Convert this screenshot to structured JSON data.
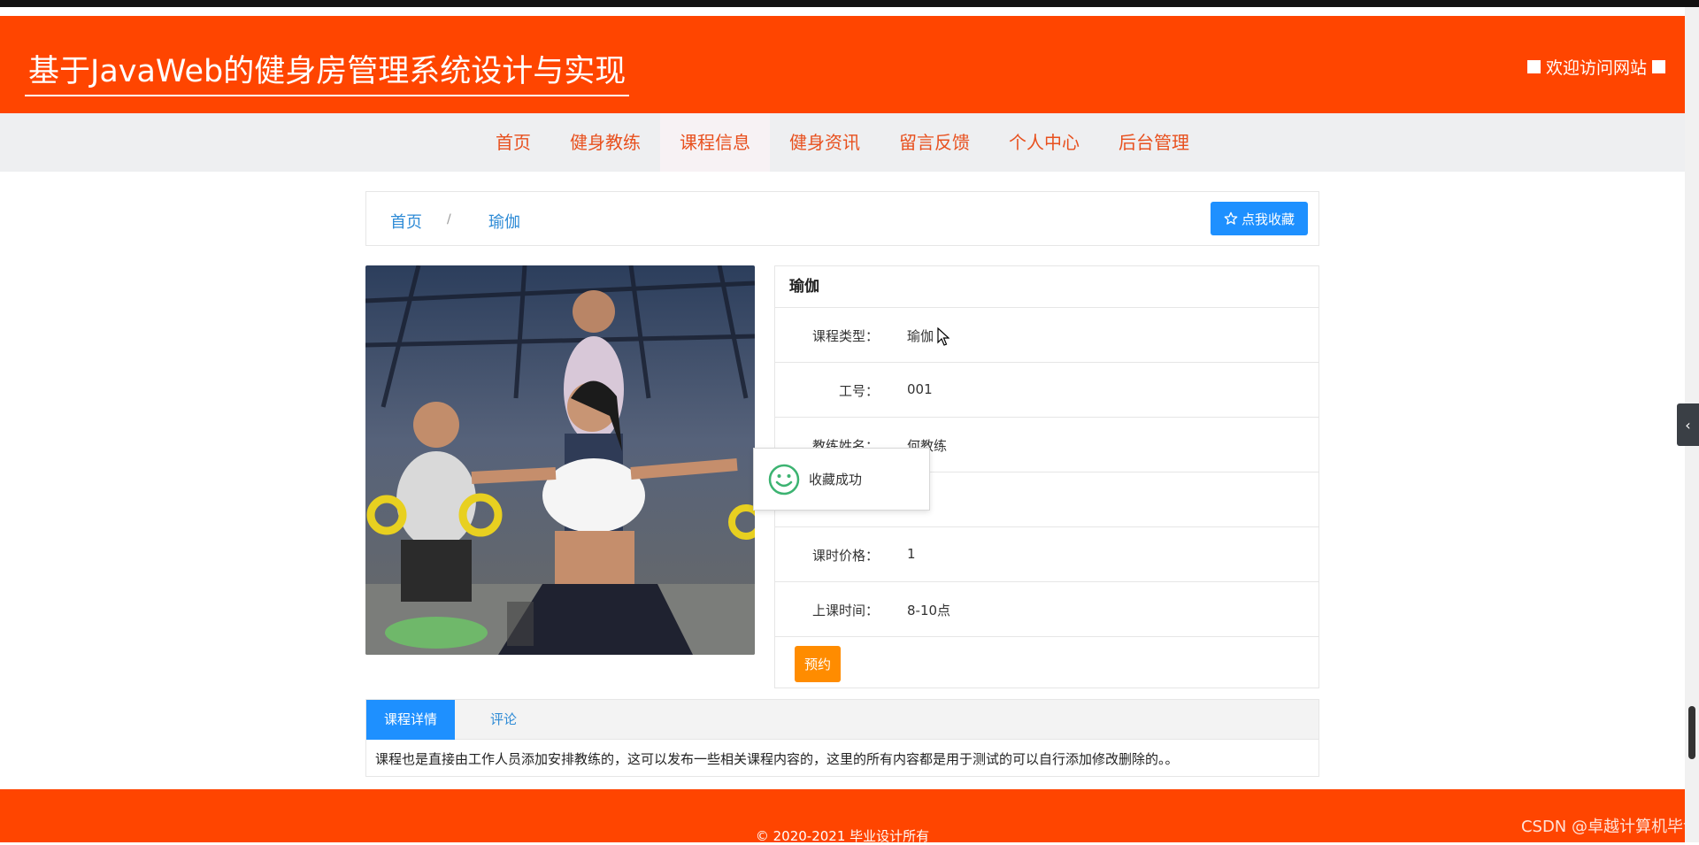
{
  "header": {
    "site_title": "基于JavaWeb的健身房管理系统设计与实现",
    "welcome_text": "欢迎访问网站"
  },
  "nav": {
    "items": [
      {
        "label": "首页"
      },
      {
        "label": "健身教练"
      },
      {
        "label": "课程信息",
        "active": true
      },
      {
        "label": "健身资讯"
      },
      {
        "label": "留言反馈"
      },
      {
        "label": "个人中心"
      },
      {
        "label": "后台管理"
      }
    ]
  },
  "breadcrumb": {
    "home": "首页",
    "separator": "/",
    "current": "瑜伽"
  },
  "favorite_button": {
    "label": "点我收藏",
    "icon": "star-icon"
  },
  "course": {
    "title": "瑜伽",
    "rows": [
      {
        "label": "课程类型：",
        "value": "瑜伽"
      },
      {
        "label": "工号：",
        "value": "001"
      },
      {
        "label": "教练姓名：",
        "value": "何教练"
      },
      {
        "label": "",
        "value": ""
      },
      {
        "label": "课时价格：",
        "value": "1"
      },
      {
        "label": "上课时间：",
        "value": "8-10点"
      }
    ],
    "book_label": "预约"
  },
  "toast": {
    "text": "收藏成功",
    "icon": "smile-icon"
  },
  "tabs": {
    "items": [
      {
        "label": "课程详情",
        "active": true
      },
      {
        "label": "评论"
      }
    ],
    "content": "课程也是直接由工作人员添加安排教练的，这可以发布一些相关课程内容的，这里的所有内容都是用于测试的可以自行添加修改删除的。。"
  },
  "footer": {
    "copyright": "© 2020-2021 毕业设计所有"
  },
  "watermark": "CSDN @卓越计算机毕设",
  "colors": {
    "brand": "#ff4500",
    "nav_text": "#e8501e",
    "primary_button": "#1e90ff",
    "book_button": "#ff8c00",
    "link": "#2e8bd6"
  }
}
